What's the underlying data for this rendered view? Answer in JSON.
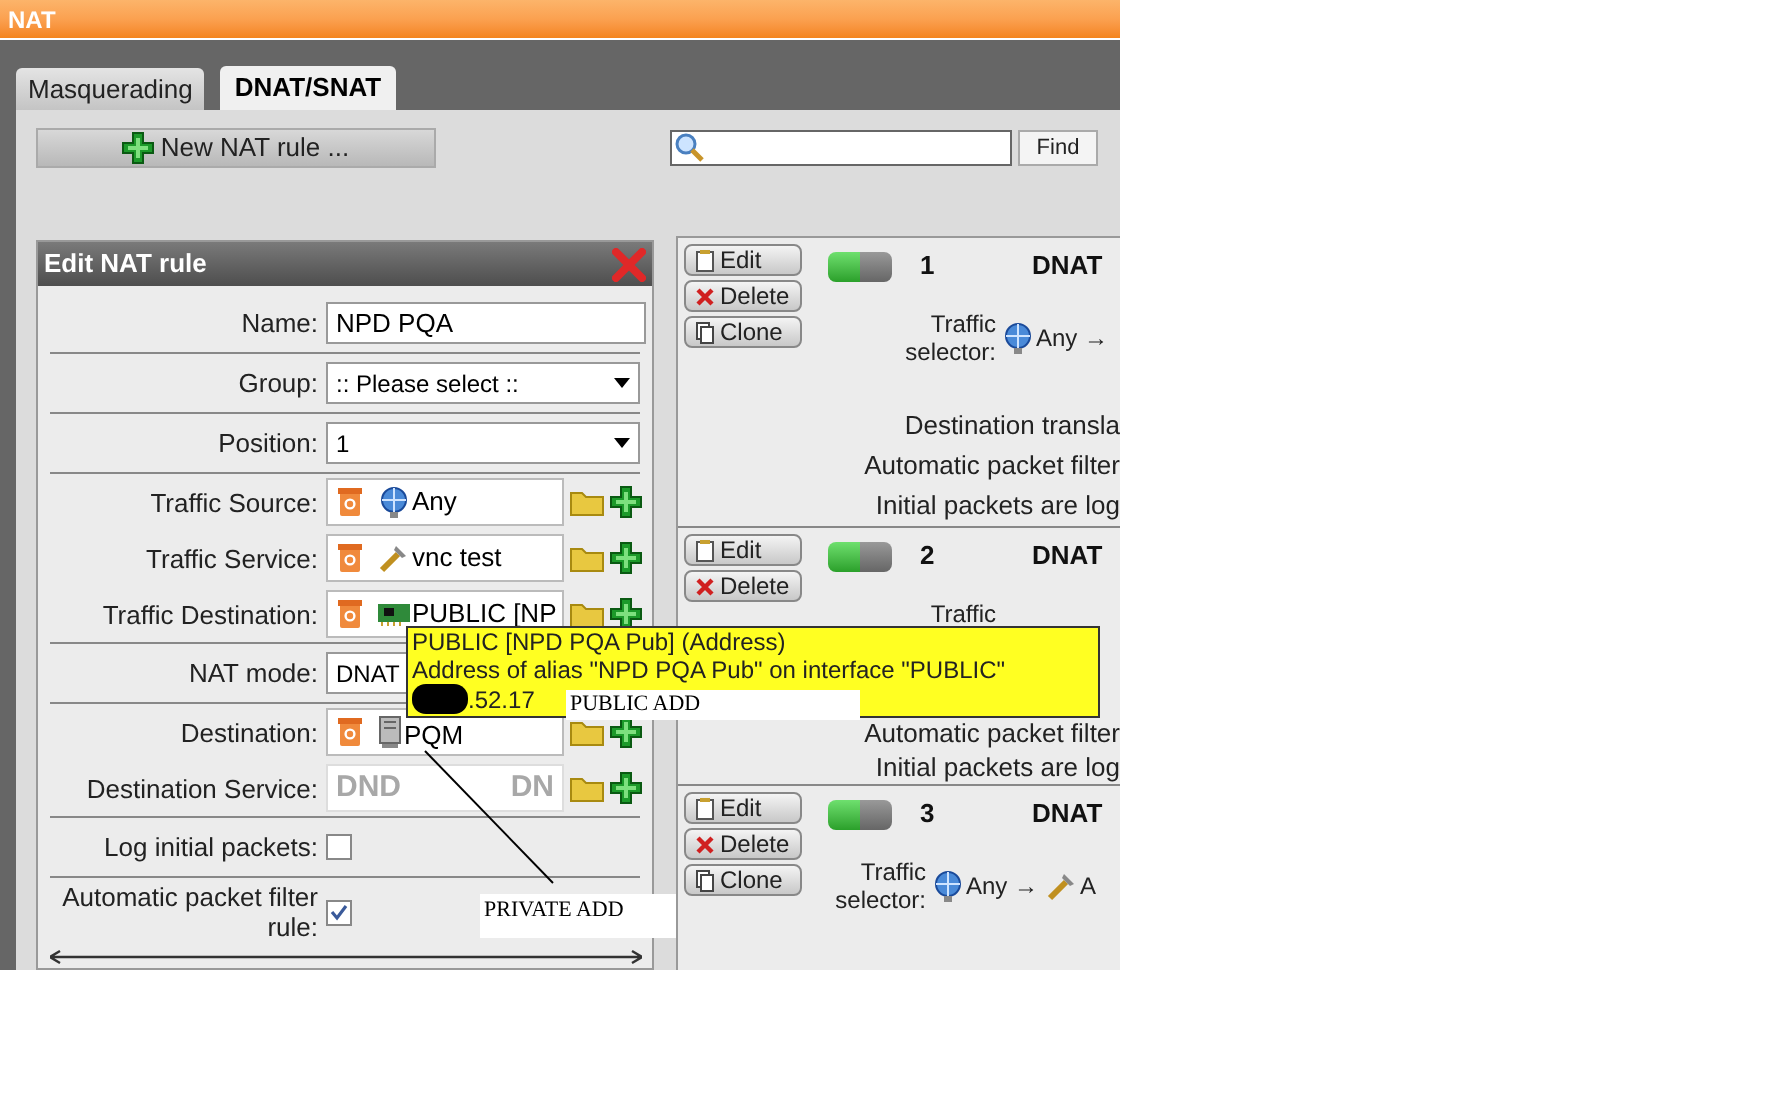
{
  "window": {
    "title": "NAT"
  },
  "tabs": [
    {
      "label": "Masquerading",
      "selected": false
    },
    {
      "label": "DNAT/SNAT",
      "selected": true
    }
  ],
  "toolbar": {
    "new_button": "New NAT rule ...",
    "find_button": "Find"
  },
  "edit_panel": {
    "title": "Edit NAT rule",
    "sections": [
      [
        {
          "kind": "text",
          "label": "Name:",
          "value": "NPD PQA"
        }
      ],
      [
        {
          "kind": "select",
          "label": "Group:",
          "value": ":: Please select ::"
        }
      ],
      [
        {
          "kind": "select",
          "label": "Position:",
          "value": "1"
        }
      ],
      [
        {
          "kind": "network",
          "label": "Traffic Source:",
          "value": "Any"
        },
        {
          "kind": "service",
          "label": "Traffic Service:",
          "value": "vnc test"
        },
        {
          "kind": "interface",
          "label": "Traffic Destination:",
          "value": "PUBLIC [NP"
        }
      ],
      [
        {
          "kind": "select",
          "label": "NAT mode:",
          "value": "DNAT"
        }
      ],
      [
        {
          "kind": "host",
          "label": "Destination:",
          "value": "PQM"
        },
        {
          "kind": "dropzone",
          "label": "Destination Service:",
          "hints": [
            "DND",
            "DN"
          ]
        }
      ],
      [
        {
          "kind": "checkbox",
          "label": "Log initial packets:",
          "checked": false
        }
      ],
      [
        {
          "kind": "checkbox",
          "label": "Automatic packet filter rule:",
          "checked": true
        }
      ]
    ]
  },
  "rules": [
    {
      "buttons": [
        "Edit",
        "Delete",
        "Clone"
      ],
      "enabled": true,
      "number": "1",
      "mode": "DNAT",
      "selector_label": [
        "Traffic",
        "selector:"
      ],
      "selector_value": "Any →",
      "service_icon": false,
      "lines": [
        "Destination transla",
        "Automatic packet filter",
        "Initial packets are log"
      ]
    },
    {
      "buttons": [
        "Edit",
        "Delete"
      ],
      "enabled": true,
      "number": "2",
      "mode": "DNAT",
      "selector_label": [
        "Traffic"
      ],
      "service_icon": false,
      "lines": [
        "Automatic packet filter",
        "Initial packets are log"
      ]
    },
    {
      "buttons": [
        "Edit",
        "Delete",
        "Clone"
      ],
      "enabled": true,
      "number": "3",
      "mode": "DNAT",
      "selector_label": [
        "Traffic",
        "selector:"
      ],
      "selector_value": "Any →",
      "service_icon": true,
      "target": "A"
    }
  ],
  "tooltip": {
    "lines": [
      "PUBLIC [NPD PQA Pub] (Address)",
      "Address of alias \"NPD PQA Pub\" on interface \"PUBLIC\"",
      ".52.17"
    ]
  },
  "annotations": {
    "public": "PUBLIC ADD",
    "private": "PRIVATE ADD"
  }
}
